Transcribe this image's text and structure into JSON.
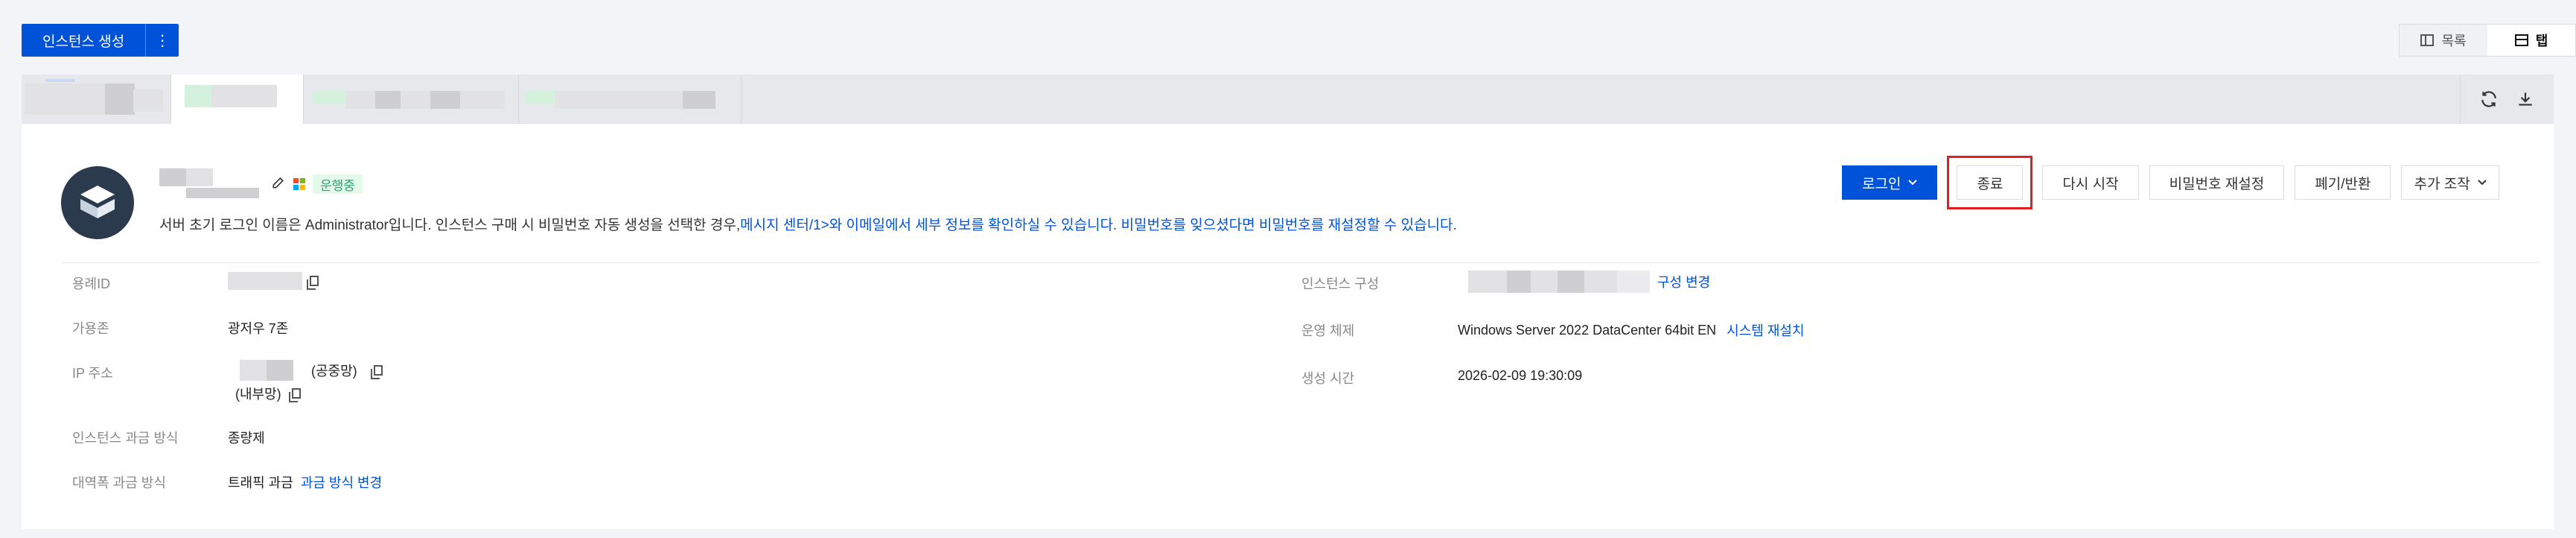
{
  "toolbar": {
    "create_label": "인스턴스 생성",
    "more_label": "⋮"
  },
  "view_toggle": {
    "list_label": "목록",
    "tab_label": "탭"
  },
  "instance": {
    "status": "운행중",
    "notice_prefix": "서버 초기 로그인 이름은 Administrator입니다. 인스턴스 구매 시 비밀번호 자동 생성을 선택한 경우,",
    "notice_link": "메시지 센터/1>와 이메일에서 세부 정보를 확인하실 수 있습니다. 비밀번호를 잊으셨다면 비밀번호를 재설정할 수 있습니다."
  },
  "actions": {
    "login": "로그인",
    "stop": "종료",
    "restart": "다시 시작",
    "reset_password": "비밀번호 재설정",
    "terminate": "폐기/반환",
    "more": "추가 조작"
  },
  "details": {
    "instance_id_label": "용례ID",
    "zone_label": "가용존",
    "zone_value": "광저우 7존",
    "ip_label": "IP 주소",
    "ip_public_suffix": "(공중망)",
    "ip_private_suffix": "(내부망)",
    "billing_label": "인스턴스 과금 방식",
    "billing_value": "종량제",
    "bandwidth_label": "대역폭 과금 방식",
    "bandwidth_value": "트래픽 과금",
    "bandwidth_link": "과금 방식 변경",
    "config_label": "인스턴스 구성",
    "config_link": "구성 변경",
    "os_label": "운영 체제",
    "os_value": "Windows Server 2022 DataCenter 64bit EN",
    "os_link": "시스템 재설치",
    "created_label": "생성 시간",
    "created_value": "2026-02-09 19:30:09"
  }
}
